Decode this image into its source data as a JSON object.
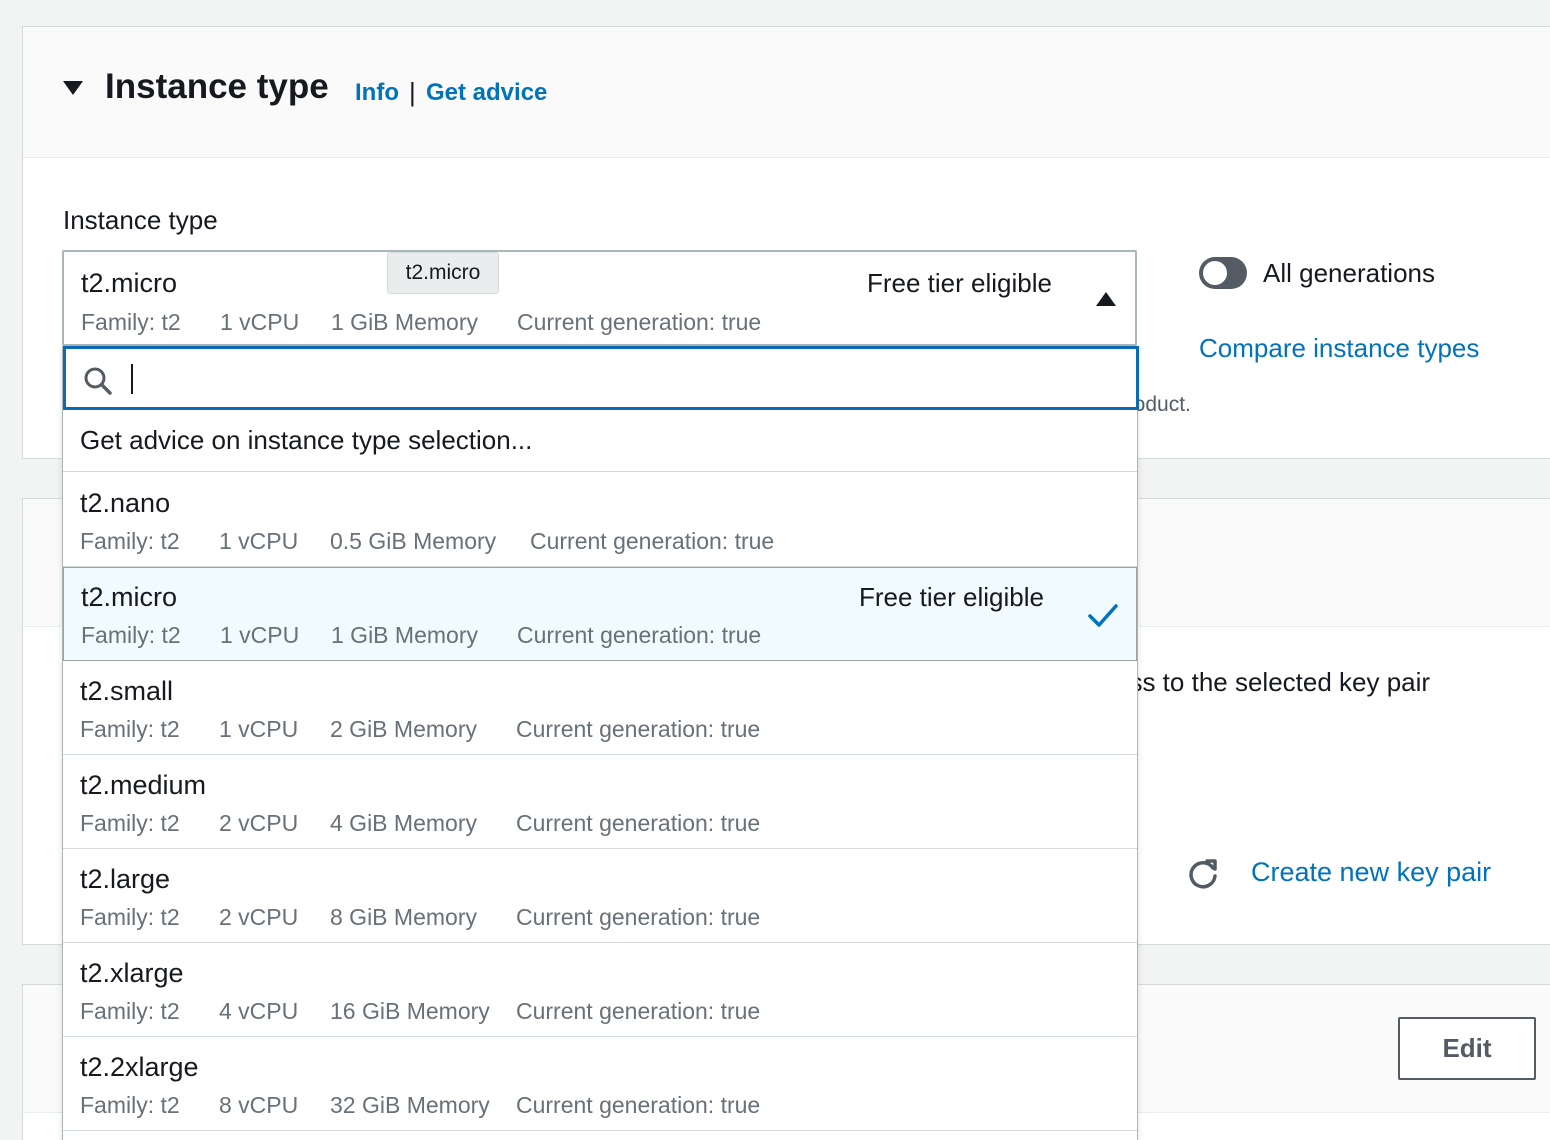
{
  "section": {
    "title": "Instance type",
    "info_link": "Info",
    "separator": "|",
    "advice_link": "Get advice"
  },
  "field": {
    "label": "Instance type"
  },
  "selected": {
    "name": "t2.micro",
    "badge": "Free tier eligible",
    "family": "Family: t2",
    "vcpu": "1 vCPU",
    "memory": "1 GiB Memory",
    "generation": "Current generation: true",
    "tooltip": "t2.micro"
  },
  "toggle": {
    "label": "All generations",
    "on": false
  },
  "compare_link": "Compare instance types",
  "partial_text_1": "product.",
  "partial_text_2": "ess to the selected key pair",
  "create_key_link": "Create new key pair",
  "edit_button": "Edit",
  "search": {
    "placeholder": "",
    "value": ""
  },
  "advice_item": "Get advice on instance type selection...",
  "options": [
    {
      "name": "t2.nano",
      "badge": "",
      "family": "Family: t2",
      "vcpu": "1 vCPU",
      "memory": "0.5 GiB Memory",
      "generation": "Current generation: true",
      "selected": false
    },
    {
      "name": "t2.micro",
      "badge": "Free tier eligible",
      "family": "Family: t2",
      "vcpu": "1 vCPU",
      "memory": "1 GiB Memory",
      "generation": "Current generation: true",
      "selected": true
    },
    {
      "name": "t2.small",
      "badge": "",
      "family": "Family: t2",
      "vcpu": "1 vCPU",
      "memory": "2 GiB Memory",
      "generation": "Current generation: true",
      "selected": false
    },
    {
      "name": "t2.medium",
      "badge": "",
      "family": "Family: t2",
      "vcpu": "2 vCPU",
      "memory": "4 GiB Memory",
      "generation": "Current generation: true",
      "selected": false
    },
    {
      "name": "t2.large",
      "badge": "",
      "family": "Family: t2",
      "vcpu": "2 vCPU",
      "memory": "8 GiB Memory",
      "generation": "Current generation: true",
      "selected": false
    },
    {
      "name": "t2.xlarge",
      "badge": "",
      "family": "Family: t2",
      "vcpu": "4 vCPU",
      "memory": "16 GiB Memory",
      "generation": "Current generation: true",
      "selected": false
    },
    {
      "name": "t2.2xlarge",
      "badge": "",
      "family": "Family: t2",
      "vcpu": "8 vCPU",
      "memory": "32 GiB Memory",
      "generation": "Current generation: true",
      "selected": false
    }
  ],
  "colors": {
    "link": "#0073bb",
    "focus": "#0a6ab5",
    "selected_bg": "#f1faff",
    "muted": "#687078"
  }
}
